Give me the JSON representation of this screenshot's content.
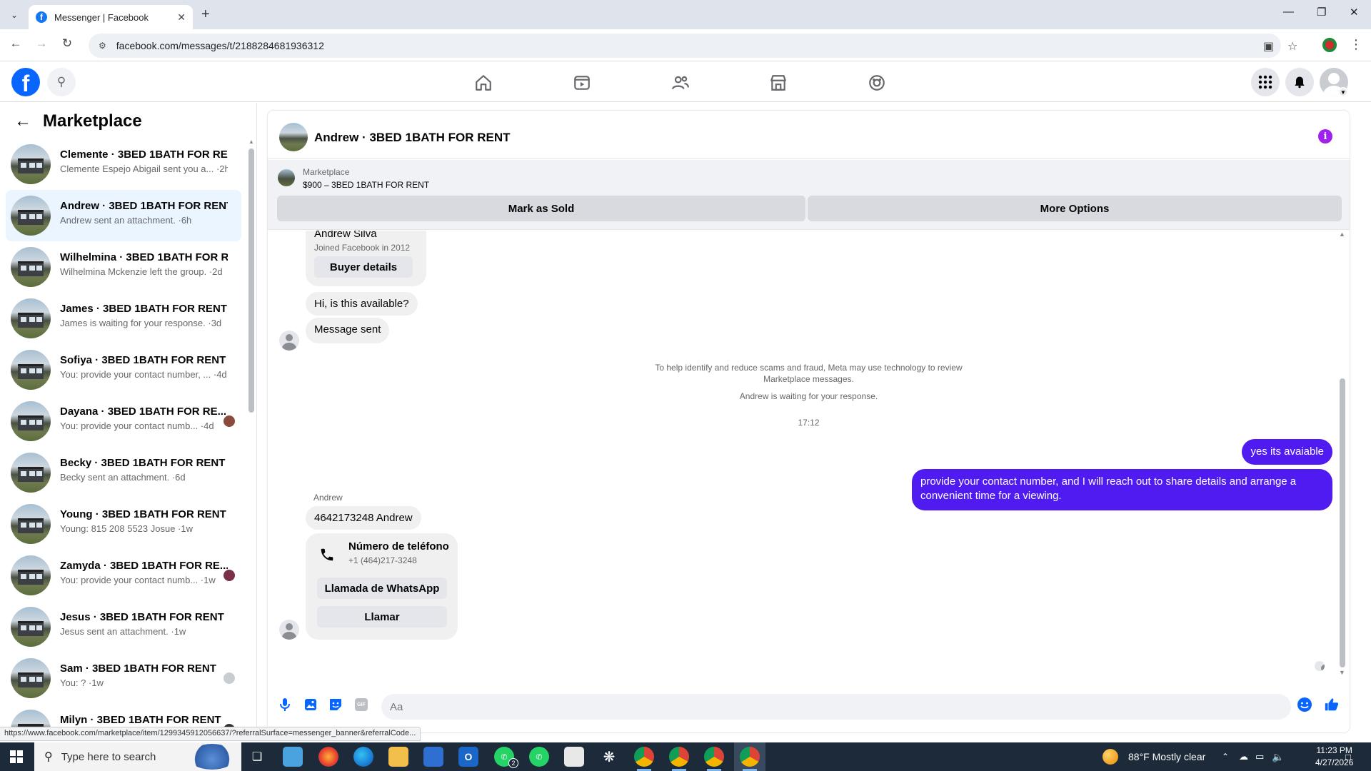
{
  "browser": {
    "tab_title": "Messenger | Facebook",
    "url": "facebook.com/messages/t/2188284681936312",
    "status_url": "https://www.facebook.com/marketplace/item/1299345912056637/?referralSurface=messenger_banner&referralCode..."
  },
  "sidebar": {
    "title": "Marketplace",
    "conversations": [
      {
        "title": "Clemente · 3BED 1BATH FOR RE...",
        "snippet": "Clemente Espejo Abigail sent you a... ·2h"
      },
      {
        "title": "Andrew · 3BED 1BATH FOR RENT",
        "snippet": "Andrew sent an attachment. ·6h"
      },
      {
        "title": "Wilhelmina · 3BED 1BATH FOR R...",
        "snippet": "Wilhelmina Mckenzie left the group. ·2d"
      },
      {
        "title": "James · 3BED 1BATH FOR RENT",
        "snippet": "James is waiting for your response. ·3d"
      },
      {
        "title": "Sofiya · 3BED 1BATH FOR RENT",
        "snippet": "You: provide your contact number, ... ·4d"
      },
      {
        "title": "Dayana · 3BED 1BATH FOR RE...",
        "snippet": "You: provide your contact numb... ·4d"
      },
      {
        "title": "Becky · 3BED 1BATH FOR RENT",
        "snippet": "Becky sent an attachment. ·6d"
      },
      {
        "title": "Young · 3BED 1BATH FOR RENT",
        "snippet": "Young: 815 208 5523 Josue ·1w"
      },
      {
        "title": "Zamyda · 3BED 1BATH FOR RE...",
        "snippet": "You: provide your contact numb... ·1w"
      },
      {
        "title": "Jesus · 3BED 1BATH FOR RENT",
        "snippet": "Jesus sent an attachment. ·1w"
      },
      {
        "title": "Sam · 3BED 1BATH FOR RENT",
        "snippet": "You: ? ·1w"
      },
      {
        "title": "Milyn · 3BED 1BATH FOR RENT",
        "snippet": ""
      }
    ]
  },
  "chat": {
    "header_name": "Andrew · 3BED 1BATH FOR RENT",
    "listing_category": "Marketplace",
    "listing_price": "$900 – 3BED 1BATH FOR RENT",
    "mark_sold": "Mark as Sold",
    "more_options": "More Options",
    "buyer_name": "Andrew Silva",
    "buyer_joined": "Joined Facebook in 2012",
    "buyer_details": "Buyer details",
    "msg1": "Hi, is this available?",
    "msg2": "Message sent",
    "notice_line1": "To help identify and reduce scams and fraud, Meta may use technology to review",
    "notice_line2": "Marketplace messages.",
    "waiting": "Andrew is waiting for your response.",
    "time": "17:12",
    "out1": "yes its avaiable",
    "out2": "provide your contact number, and I will reach out to share  details and arrange a convenient time for a viewing.",
    "sender_label": "Andrew",
    "msg3": "4642173248 Andrew",
    "phone_title": "Número de teléfono",
    "phone_number": "+1 (464)217-3248",
    "whatsapp_btn": "Llamada de WhatsApp",
    "call_btn": "Llamar",
    "composer_placeholder": "Aa"
  },
  "taskbar": {
    "search_placeholder": "Type here to search",
    "weather": "88°F  Mostly clear",
    "time": "11:23 PM",
    "date": "4/27/2026",
    "notif_count": "2"
  }
}
